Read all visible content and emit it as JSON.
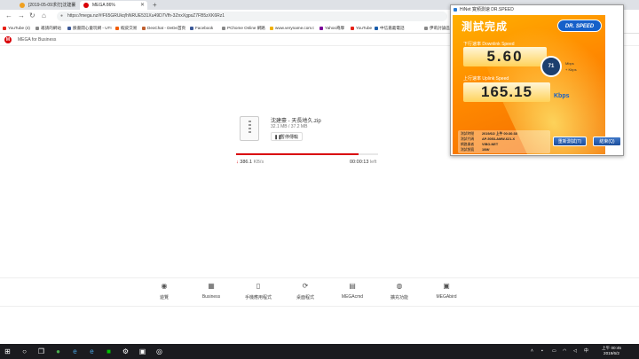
{
  "browser": {
    "tabs": [
      {
        "title": "[2019-05-09求打]沈建豪",
        "active": false
      },
      {
        "title": "MEGA 86%",
        "active": true
      }
    ],
    "new_tab_label": "+",
    "url": "https://mega.nz/#!F65GRUkq!hNRUE531Xu49D7Vfh-3ZnxXgpsZ7FB5zXK6Rz1",
    "bookmarks": [
      "YouTube (4)",
      "邀請的網站",
      "臉書開心童玩網 - UTI",
      "蝦皮交易",
      "DeoChat - DeDe首頁",
      "Facebook",
      "PChome Online 網路",
      "www.veryname.com.t",
      "Yahoo奇摩",
      "YouTube",
      "中信嘉義電話",
      "伊莉討論區"
    ]
  },
  "mega": {
    "business_label": "MEGA for Business",
    "file_name": "沈建豪 - 天長地久.zip",
    "file_size": "32.1 MB / 37.2 MB",
    "pause_label": "暫停傳輸",
    "progress_percent": 86,
    "speed_value": "386.1",
    "speed_unit": "KB/s",
    "remaining_value": "00:00:13",
    "remaining_unit": "left",
    "footer": [
      "遊覽",
      "Business",
      "手機應用程式",
      "桌面程式",
      "MEGAcmd",
      "擴充功能",
      "MEGAbird"
    ]
  },
  "speedtest": {
    "window_title": "HiNet 寬頻測速 DR.SPEED",
    "heading": "測試完成",
    "logo": "DR. SPEED",
    "download_label": "下行速率 Downlink Speed",
    "download_value": "5.60",
    "badge_value": "71",
    "download_unit_top": "Mbps",
    "download_unit_bottom": "+ Kbps",
    "upload_label": "上行速率 Uplink Speed",
    "upload_value": "165.15",
    "upload_unit": "Kbps",
    "info": [
      {
        "key": "測試時間",
        "value": "2019/6/2 上午 00:36:38"
      },
      {
        "key": "測試代碼",
        "value": "AP-5053-AMW-621-X"
      },
      {
        "key": "網路業者",
        "value": "VIBO-NET"
      },
      {
        "key": "測試頻寬",
        "value": "10M/"
      }
    ],
    "retest_label": "重新測試(T)",
    "close_label": "結束(Q)"
  },
  "taskbar": {
    "time": "上午 00:45",
    "date": "2019/6/2",
    "lang": "中"
  },
  "colors": {
    "mega_red": "#d90007",
    "speedtest_orange": "#ff8a00",
    "speedtest_blue": "#1660c9"
  }
}
